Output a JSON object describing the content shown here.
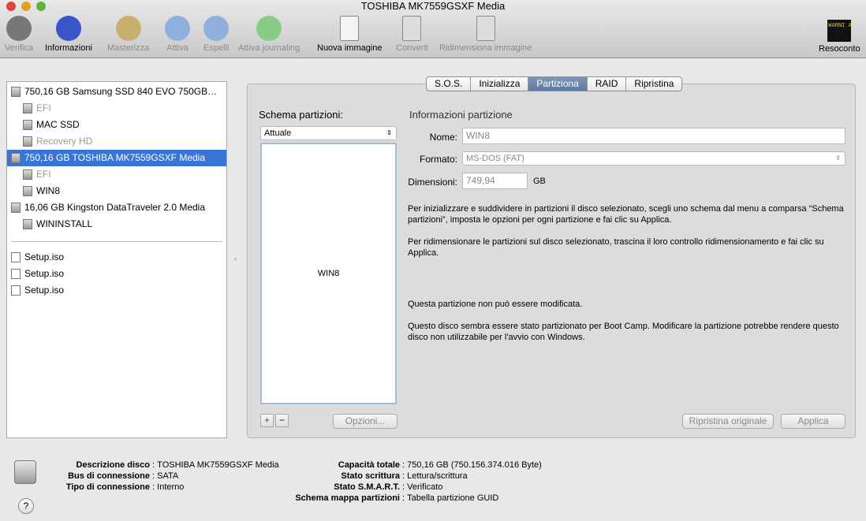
{
  "window": {
    "title": "TOSHIBA MK7559GSXF Media"
  },
  "toolbar": [
    {
      "label": "Verifica",
      "icon": "microscope-icon",
      "enabled": false
    },
    {
      "label": "Informazioni",
      "icon": "info-icon",
      "enabled": true
    },
    {
      "label": "Masterizza",
      "icon": "burn-icon",
      "enabled": false
    },
    {
      "label": "Attiva",
      "icon": "mount-icon",
      "enabled": false
    },
    {
      "label": "Espelli",
      "icon": "eject-icon",
      "enabled": false
    },
    {
      "label": "Attiva journaling",
      "icon": "journaling-icon",
      "enabled": false
    },
    {
      "label": "Nuova immagine",
      "icon": "new-image-icon",
      "enabled": true
    },
    {
      "label": "Converti",
      "icon": "convert-icon",
      "enabled": false
    },
    {
      "label": "Ridimensiona immagine",
      "icon": "resize-image-icon",
      "enabled": false
    }
  ],
  "log": {
    "label": "Resoconto",
    "icon_text": "WARNI AY 7:36"
  },
  "sidebar": {
    "items": [
      {
        "label": "750,16 GB Samsung SSD 840 EVO 750GB…",
        "level": 0,
        "dim": false,
        "selected": false
      },
      {
        "label": "EFI",
        "level": 1,
        "dim": true,
        "selected": false
      },
      {
        "label": "MAC SSD",
        "level": 1,
        "dim": false,
        "selected": false
      },
      {
        "label": "Recovery HD",
        "level": 1,
        "dim": true,
        "selected": false
      },
      {
        "label": "750,16 GB TOSHIBA MK7559GSXF Media",
        "level": 0,
        "dim": false,
        "selected": true
      },
      {
        "label": "EFI",
        "level": 1,
        "dim": true,
        "selected": false
      },
      {
        "label": "WIN8",
        "level": 1,
        "dim": false,
        "selected": false
      },
      {
        "label": "16,06 GB Kingston DataTraveler 2.0 Media",
        "level": 0,
        "dim": false,
        "selected": false
      },
      {
        "label": "WININSTALL",
        "level": 1,
        "dim": false,
        "selected": false
      }
    ],
    "images": [
      "Setup.iso",
      "Setup.iso",
      "Setup.iso"
    ]
  },
  "tabs": [
    {
      "label": "S.O.S.",
      "active": false
    },
    {
      "label": "Inizializza",
      "active": false
    },
    {
      "label": "Partiziona",
      "active": true
    },
    {
      "label": "RAID",
      "active": false
    },
    {
      "label": "Ripristina",
      "active": false
    }
  ],
  "partition": {
    "scheme_label": "Schema partizioni:",
    "scheme_value": "Attuale",
    "block_label": "WIN8",
    "add": "+",
    "remove": "−",
    "options": "Opzioni...",
    "info_title": "Informazioni partizione",
    "name_label": "Nome:",
    "name_value": "WIN8",
    "format_label": "Formato:",
    "format_value": "MS-DOS (FAT)",
    "size_label": "Dimensioni:",
    "size_value": "749,94",
    "size_unit": "GB",
    "help1": "Per inizializzare e suddividere in partizioni il disco selezionato, scegli uno schema dal menu a comparsa “Schema partizioni”, imposta le opzioni per ogni partizione e fai clic su Applica.",
    "help2": "Per ridimensionare le partizioni sul disco selezionato, trascina il loro controllo ridimensionamento e fai clic su Applica.",
    "note1": "Questa partizione non può essere modificata.",
    "note2": "Questo disco sembra essere stato partizionato per Boot Camp. Modificare la partizione potrebbe rendere questo disco non utilizzabile per l'avvio con Windows.",
    "revert": "Ripristina originale",
    "apply": "Applica"
  },
  "disk_info": {
    "left": [
      {
        "k": "Descrizione disco",
        "v": "TOSHIBA MK7559GSXF Media"
      },
      {
        "k": "Bus di connessione",
        "v": "SATA"
      },
      {
        "k": "Tipo di connessione",
        "v": "Interno"
      }
    ],
    "right": [
      {
        "k": "Capacità totale",
        "v": "750,16 GB (750.156.374.016 Byte)"
      },
      {
        "k": "Stato scrittura",
        "v": "Lettura/scrittura"
      },
      {
        "k": "Stato S.M.A.R.T.",
        "v": "Verificato"
      },
      {
        "k": "Schema mappa partizioni",
        "v": "Tabella partizione GUID"
      }
    ],
    "help": "?"
  }
}
